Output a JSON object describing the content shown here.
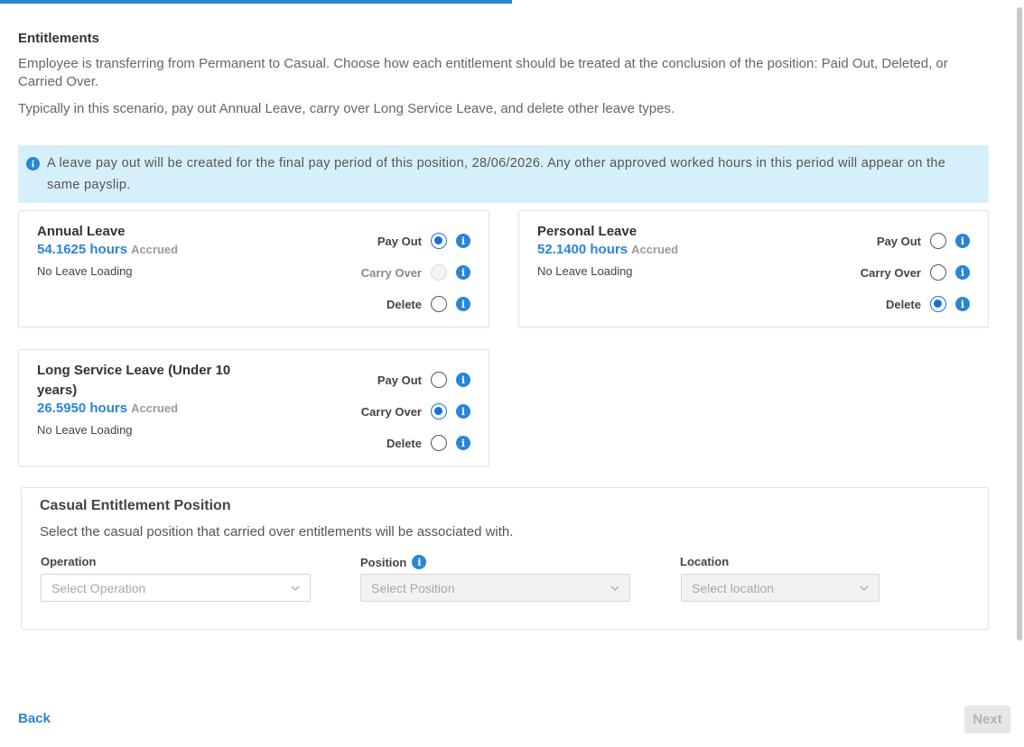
{
  "progress": {
    "fraction": 0.5
  },
  "section": {
    "title": "Entitlements",
    "intro": "Employee is transferring from Permanent to Casual. Choose how each entitlement should be treated at the conclusion of the position: Paid Out, Deleted, or Carried Over.",
    "typical": "Typically in this scenario, pay out Annual Leave, carry over Long Service Leave, and delete other leave types."
  },
  "banner": {
    "icon": "info-icon",
    "text": "A leave pay out will be created for the final pay period of this position, 28/06/2026. Any other approved worked hours in this period will appear on the same payslip."
  },
  "options": {
    "pay_out": "Pay Out",
    "carry_over": "Carry Over",
    "delete": "Delete"
  },
  "entitlements": [
    {
      "name": "Annual Leave",
      "hours": "54.1625 hours",
      "accrued": "Accrued",
      "loading": "No Leave Loading",
      "selected": "pay_out",
      "carry_over_disabled": true
    },
    {
      "name": "Personal Leave",
      "hours": "52.1400 hours",
      "accrued": "Accrued",
      "loading": "No Leave Loading",
      "selected": "delete",
      "carry_over_disabled": false
    },
    {
      "name": "Long Service Leave (Under 10 years)",
      "hours": "26.5950 hours",
      "accrued": "Accrued",
      "loading": "No Leave Loading",
      "selected": "carry_over",
      "carry_over_disabled": false
    }
  ],
  "casual": {
    "title": "Casual Entitlement Position",
    "description": "Select the casual position that carried over entitlements will be associated with.",
    "operation": {
      "label": "Operation",
      "placeholder": "Select Operation"
    },
    "position": {
      "label": "Position",
      "placeholder": "Select Position"
    },
    "location": {
      "label": "Location",
      "placeholder": "Select location"
    }
  },
  "footer": {
    "back": "Back",
    "next": "Next"
  },
  "colors": {
    "accent": "#2a85d8",
    "radio": "#1a6fe0",
    "banner_bg": "#d6f0fb"
  }
}
